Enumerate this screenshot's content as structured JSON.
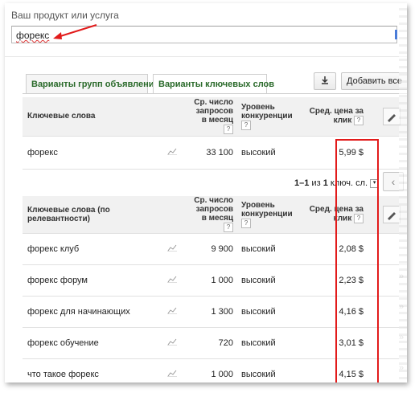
{
  "header": {
    "label": "Ваш продукт или услуга"
  },
  "search": {
    "value": "форекс"
  },
  "tabs": [
    {
      "label": "Варианты групп объявлений"
    },
    {
      "label": "Варианты ключевых слов"
    }
  ],
  "toolbar": {
    "add_all_label": "Добавить все"
  },
  "table1": {
    "headers": {
      "keyword": "Ключевые слова",
      "searches": "Ср. число запросов в месяц",
      "competition": "Уровень конкуренции",
      "cpc": "Сред. цена за клик",
      "help": "?"
    },
    "rows": [
      {
        "keyword": "форекс",
        "searches": "33 100",
        "competition": "высокий",
        "cpc": "5,99 $"
      }
    ]
  },
  "pager": {
    "range": "1–1",
    "of": "из",
    "count": "1",
    "unit": "ключ. сл."
  },
  "table2": {
    "headers": {
      "keyword": "Ключевые слова (по релевантности)",
      "searches": "Ср. число запросов в месяц",
      "competition": "Уровень конкуренции",
      "cpc": "Сред. цена за клик",
      "help": "?"
    },
    "rows": [
      {
        "keyword": "форекс клуб",
        "searches": "9 900",
        "competition": "высокий",
        "cpc": "2,08 $"
      },
      {
        "keyword": "форекс форум",
        "searches": "1 000",
        "competition": "высокий",
        "cpc": "2,23 $"
      },
      {
        "keyword": "форекс для начинающих",
        "searches": "1 300",
        "competition": "высокий",
        "cpc": "4,16 $"
      },
      {
        "keyword": "форекс обучение",
        "searches": "720",
        "competition": "высокий",
        "cpc": "3,01 $"
      },
      {
        "keyword": "что такое форекс",
        "searches": "1 000",
        "competition": "высокий",
        "cpc": "4,15 $"
      }
    ]
  },
  "colors": {
    "highlight": "#e21b1b",
    "tab_text": "#2a6a2a"
  }
}
